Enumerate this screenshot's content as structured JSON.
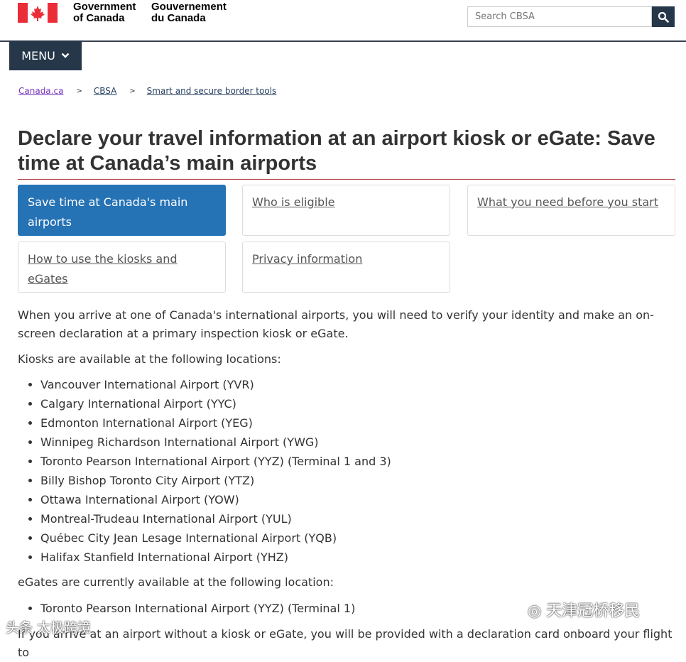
{
  "header": {
    "gov_en_line1": "Government",
    "gov_en_line2": "of Canada",
    "gov_fr_line1": "Gouvernement",
    "gov_fr_line2": "du Canada",
    "search_placeholder": "Search CBSA",
    "menu_label": "MENU"
  },
  "breadcrumb": [
    "Canada.ca",
    "CBSA",
    "Smart and secure border tools"
  ],
  "title": "Declare your travel information at an airport kiosk or eGate: Save time at Canada’s main airports",
  "tabs": [
    "Save time at Canada's main airports",
    "Who is eligible",
    "What you need before you start",
    "How to use the kiosks and eGates",
    "Privacy information"
  ],
  "intro": "When you arrive at one of Canada's international airports, you will need to verify your identity and make an on-screen declaration at a primary inspection kiosk or eGate.",
  "kiosks_heading": "Kiosks are available at the following locations:",
  "kiosks": [
    "Vancouver International Airport (YVR)",
    "Calgary International Airport (YYC)",
    "Edmonton International Airport (YEG)",
    "Winnipeg Richardson International Airport (YWG)",
    "Toronto Pearson International Airport (YYZ) (Terminal 1 and 3)",
    "Billy Bishop Toronto City Airport (YTZ)",
    "Ottawa International Airport (YOW)",
    "Montreal-Trudeau International Airport (YUL)",
    "Québec City Jean Lesage International Airport (YQB)",
    "Halifax Stanfield International Airport (YHZ)"
  ],
  "egates_heading": "eGates are currently available at the following location:",
  "egates": [
    "Toronto Pearson International Airport (YYZ) (Terminal 1)"
  ],
  "closing": "If you arrive at an airport without a kiosk or eGate, you will be provided with a declaration card onboard your flight to",
  "watermarks": {
    "left": "头条 太极跨境",
    "right": "天津冠桥移民"
  },
  "colors": {
    "flag_red": "#eb2d37",
    "nav_dark": "#26374a",
    "active_tab": "#2572b4",
    "title_rule": "#af3c43"
  }
}
